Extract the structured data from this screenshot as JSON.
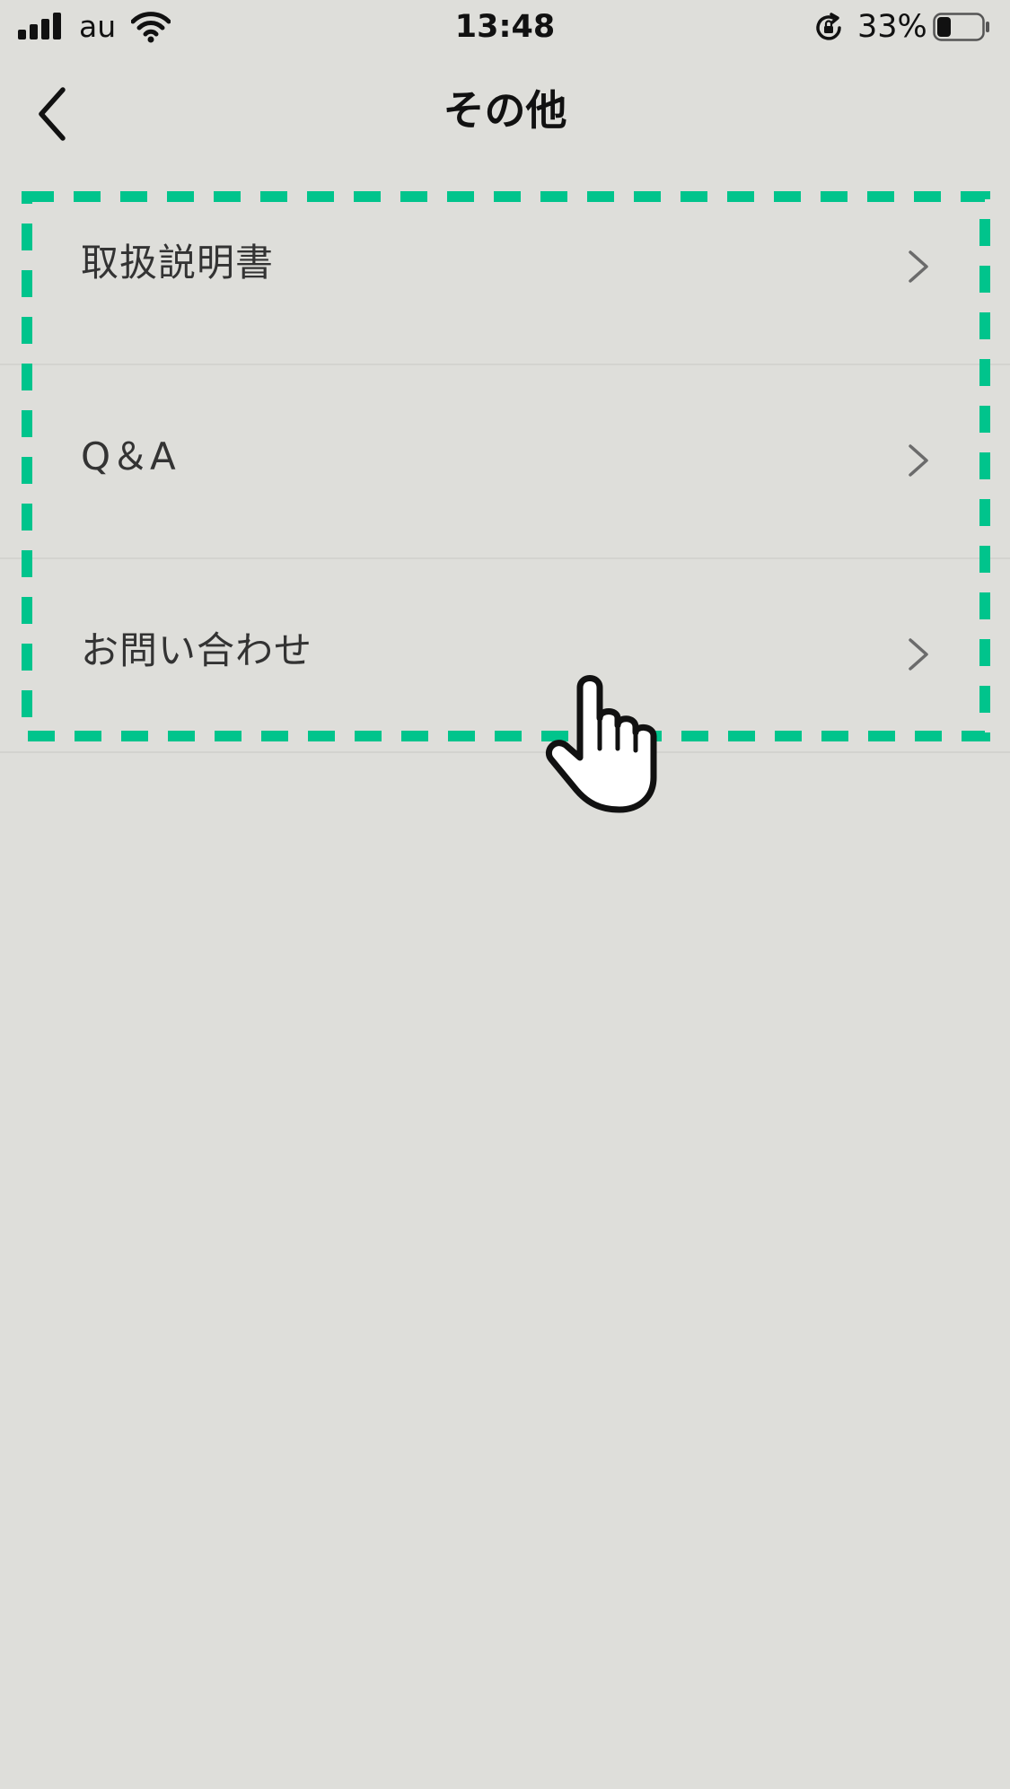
{
  "status_bar": {
    "carrier": "au",
    "time": "13:48",
    "battery_percent": "33%",
    "battery_level": 0.33,
    "icons": {
      "signal": "cellular-signal-icon",
      "wifi": "wifi-icon",
      "rotation_lock": "rotation-lock-icon",
      "battery": "battery-icon"
    }
  },
  "nav": {
    "title": "その他",
    "back_icon": "chevron-left-icon"
  },
  "menu": {
    "items": [
      {
        "label": "取扱説明書",
        "icon": "chevron-right-icon"
      },
      {
        "label": "Q＆A",
        "icon": "chevron-right-icon"
      },
      {
        "label": "お問い合わせ",
        "icon": "chevron-right-icon"
      }
    ]
  },
  "annotation": {
    "highlight_color": "#00c48c",
    "pointer_icon": "pointing-hand-icon"
  },
  "colors": {
    "background": "#dededa",
    "text": "#333333",
    "chevron": "#6b6b6b"
  }
}
